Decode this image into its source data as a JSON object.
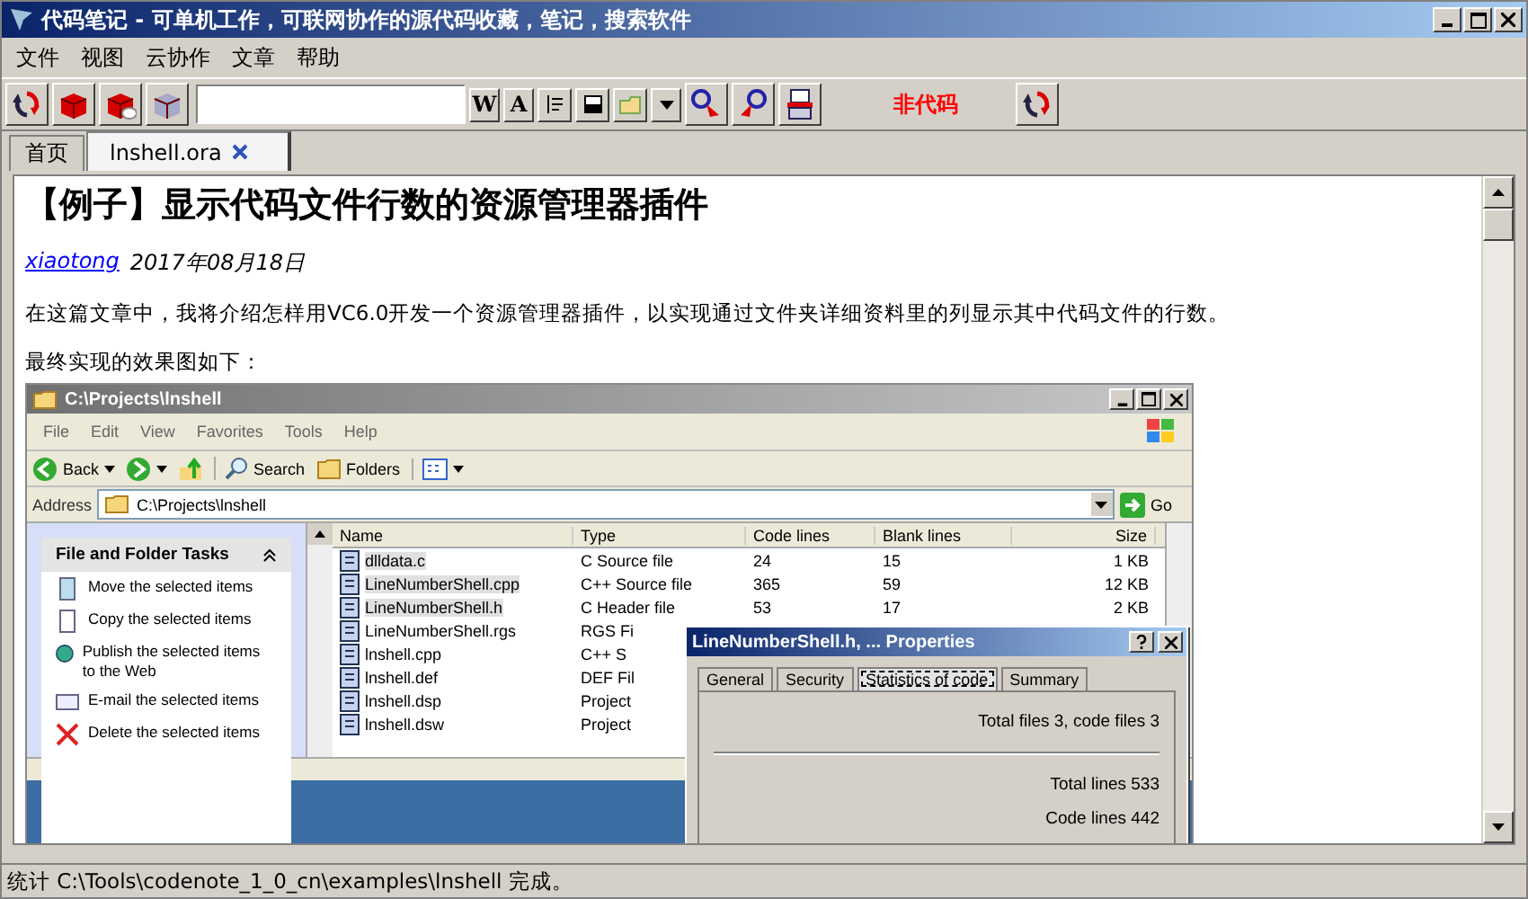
{
  "window": {
    "title": "代码笔记 - 可单机工作，可联网协作的源代码收藏，笔记，搜索软件"
  },
  "menu": [
    "文件",
    "视图",
    "云协作",
    "文章",
    "帮助"
  ],
  "toolbar": [
    {
      "kind": "refresh"
    },
    {
      "kind": "box"
    },
    {
      "kind": "box_cloud"
    },
    {
      "kind": "box_gray"
    },
    {
      "kind": "field"
    },
    {
      "kind": "key",
      "text": "W"
    },
    {
      "kind": "key",
      "text": "A"
    },
    {
      "kind": "indent"
    },
    {
      "kind": "window"
    },
    {
      "kind": "folder"
    },
    {
      "kind": "dropdown"
    },
    {
      "kind": "find_prev"
    },
    {
      "kind": "find_next"
    },
    {
      "kind": "print"
    },
    {
      "kind": "label",
      "text": "非代码"
    },
    {
      "kind": "refresh"
    }
  ],
  "tabs": [
    {
      "label": "首页",
      "selected": false,
      "closable": false
    },
    {
      "label": "lnshell.ora",
      "selected": true,
      "closable": true
    }
  ],
  "article": {
    "title": "【例子】显示代码文件行数的资源管理器插件",
    "author": "xiaotong",
    "date": "2017年08月18日",
    "paragraphs": [
      "在这篇文章中，我将介绍怎样用VC6.0开发一个资源管理器插件，以实现通过文件夹详细资料里的列显示其中代码文件的行数。",
      "最终实现的效果图如下："
    ]
  },
  "figure": {
    "title": "C:\\Projects\\lnshell",
    "menu": [
      "File",
      "Edit",
      "View",
      "Favorites",
      "Tools",
      "Help"
    ],
    "toolbar": [
      {
        "kind": "back",
        "label": "Back"
      },
      {
        "kind": "forward"
      },
      {
        "kind": "up"
      },
      {
        "kind": "search",
        "label": "Search"
      },
      {
        "kind": "folders",
        "label": "Folders"
      },
      {
        "kind": "views"
      }
    ],
    "address_label": "Address",
    "address": "C:\\Projects\\lnshell",
    "go": "Go",
    "tasks_title": "File and Folder Tasks",
    "tasks": [
      {
        "kind": "move",
        "label": "Move the selected items"
      },
      {
        "kind": "copy",
        "label": "Copy the selected items"
      },
      {
        "kind": "publish",
        "label": "Publish the selected items to the Web"
      },
      {
        "kind": "email",
        "label": "E-mail the selected items"
      },
      {
        "kind": "delete",
        "label": "Delete the selected items"
      }
    ],
    "columns": [
      "Name",
      "Type",
      "Code lines",
      "Blank lines",
      "Size"
    ],
    "files": [
      {
        "name": "dlldata.c",
        "type": "C Source file",
        "code": "24",
        "blank": "15",
        "size": "1 KB",
        "selected": true
      },
      {
        "name": "LineNumberShell.cpp",
        "type": "C++ Source file",
        "code": "365",
        "blank": "59",
        "size": "12 KB",
        "selected": true
      },
      {
        "name": "LineNumberShell.h",
        "type": "C Header file",
        "code": "53",
        "blank": "17",
        "size": "2 KB",
        "selected": true
      },
      {
        "name": "LineNumberShell.rgs",
        "type": "RGS Fi",
        "selected": false
      },
      {
        "name": "lnshell.cpp",
        "type": "C++ S",
        "selected": false
      },
      {
        "name": "lnshell.def",
        "type": "DEF Fil",
        "selected": false
      },
      {
        "name": "lnshell.dsp",
        "type": "Project",
        "selected": false
      },
      {
        "name": "lnshell.dsw",
        "type": "Project",
        "selected": false
      }
    ],
    "dialog": {
      "title": "LineNumberShell.h, ... Properties",
      "tabs": [
        {
          "label": "General",
          "selected": false
        },
        {
          "label": "Security",
          "selected": false
        },
        {
          "label": "Statistics of code",
          "selected": true
        },
        {
          "label": "Summary",
          "selected": false
        }
      ],
      "summary": "Total files 3, code files 3",
      "lines": [
        "Total lines 533",
        "Code lines 442"
      ]
    }
  },
  "status_bar": "统计 C:\\Tools\\codenote_1_0_cn\\examples\\lnshell 完成。"
}
